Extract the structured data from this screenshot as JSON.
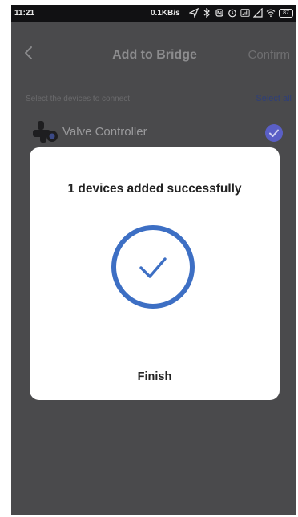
{
  "status_bar": {
    "time": "11:21",
    "network_speed": "0.1KB/s",
    "battery": "87",
    "icons": [
      "send-icon",
      "bluetooth-icon",
      "nfc-icon",
      "alarm-icon",
      "signal-4g-icon",
      "signal-icon",
      "wifi-icon",
      "battery-icon"
    ]
  },
  "header": {
    "back_icon": "chevron-left-icon",
    "title": "Add to Bridge",
    "confirm_label": "Confirm"
  },
  "device_list": {
    "subtitle": "Select the devices to connect",
    "select_all_label": "Select all",
    "items": [
      {
        "name": "Valve Controller",
        "icon": "valve-icon",
        "selected": true
      }
    ]
  },
  "dialog": {
    "message": "1 devices added successfully",
    "icon": "success-check-icon",
    "finish_label": "Finish"
  },
  "colors": {
    "overlay_background": "#4a4a4c",
    "accent_blue": "#3d6fc4",
    "selected_check": "#5a5fc6",
    "dialog_background": "#ffffff"
  }
}
